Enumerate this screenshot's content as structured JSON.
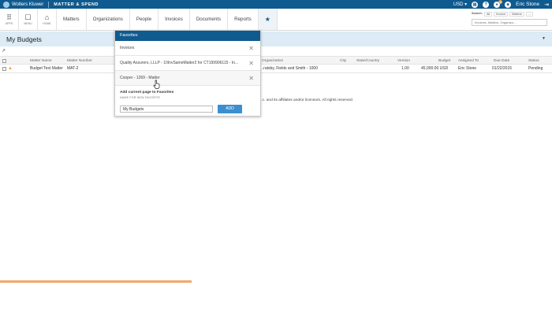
{
  "topbar": {
    "brand": "Wolters Kluwer",
    "product": "MATTER & SPEND",
    "currency": "USD",
    "notification_count": "3",
    "user": "Eric Stone"
  },
  "nav": {
    "apps": "APPS",
    "menu": "MENU",
    "home": "HOME",
    "links": [
      "Matters",
      "Organizations",
      "People",
      "Invoices",
      "Documents",
      "Reports"
    ]
  },
  "search": {
    "label": "Search:",
    "tabs": [
      "All",
      "Invoice",
      "Matters",
      "..."
    ],
    "placeholder": "Invoices, Matters, Organiza..."
  },
  "page": {
    "title": "My Budgets"
  },
  "table": {
    "headers": [
      "Matter Name",
      "Matter Number",
      "Organization",
      "City",
      "State/Country",
      "Version",
      "Budget",
      "Assigned To",
      "Due Date",
      "Status"
    ],
    "rows": [
      {
        "matter_name": "Budget Test Matter",
        "matter_number": "MAT-2",
        "organization": "...ratsby, Fields and Smith - 1000",
        "city": "",
        "state_country": "",
        "version": "1.00",
        "budget": "45,000.00 USD",
        "assigned_to": "Eric Stone",
        "due_date": "01/22/2015",
        "status": "Pending"
      }
    ],
    "copyright": "..c. and its affiliates and/or licensors. All rights reserved."
  },
  "favorites": {
    "title": "Favorites",
    "items": [
      "Invoices",
      "Quality Assurers, LLLP - 10InvSameMatter2 for CT199906115 - In...",
      "Cooper - 1269 - Matter"
    ],
    "add_label": "Add current page to Favorites",
    "name_label": "NAME FOR NEW FAVORITE",
    "name_value": "My Budgets",
    "add_button": "ADD"
  }
}
